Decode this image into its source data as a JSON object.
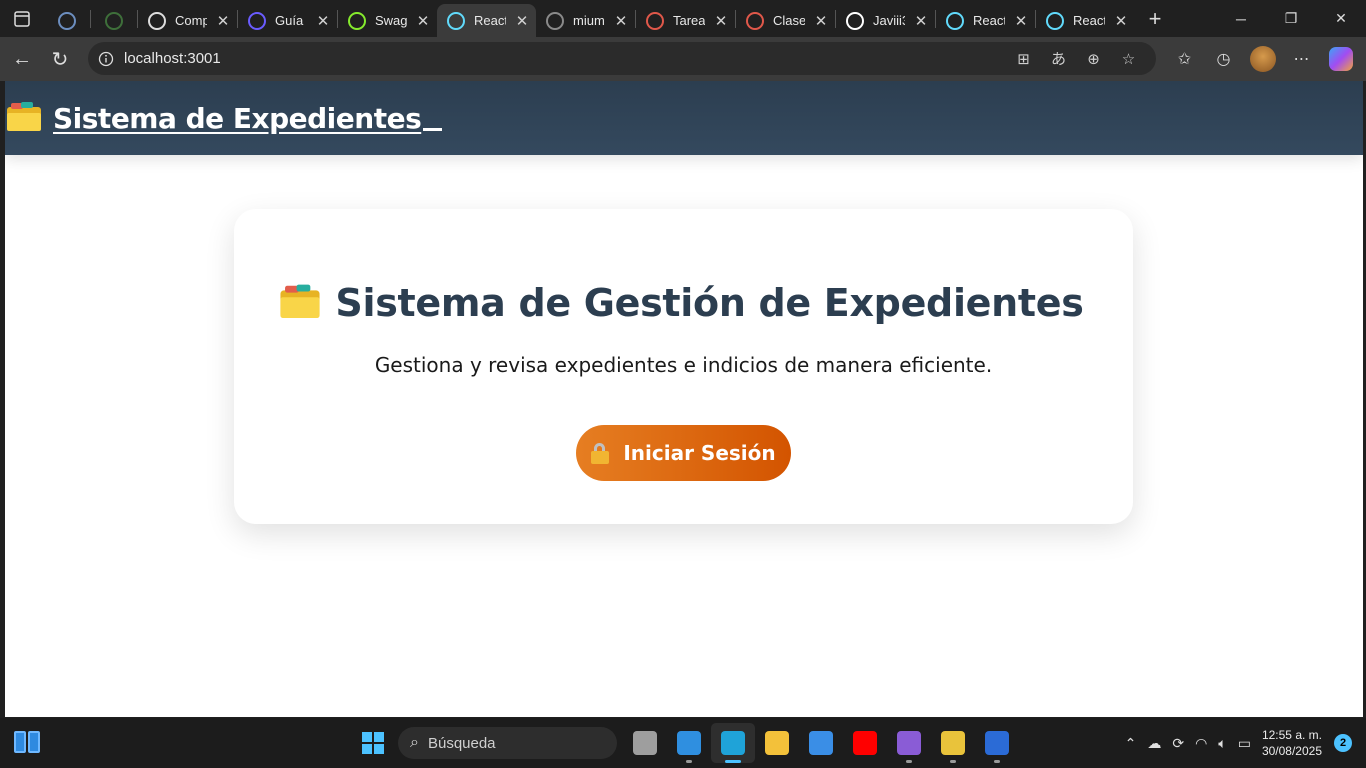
{
  "browser": {
    "tabs": [
      {
        "title": "",
        "icon": "app-icon",
        "color": "#6c8ebf"
      },
      {
        "title": "",
        "icon": "app-icon",
        "color": "#3e6f3a"
      },
      {
        "title": "Comp",
        "icon": "chatgpt-icon",
        "color": "#dddddd"
      },
      {
        "title": "Guía",
        "icon": "app-icon",
        "color": "#6a5cff"
      },
      {
        "title": "Swag",
        "icon": "swagger-icon",
        "color": "#85ea2d"
      },
      {
        "title": "React",
        "icon": "react-icon",
        "color": "#61dafb"
      },
      {
        "title": "mium",
        "icon": "app-icon",
        "color": "#8a8a8a"
      },
      {
        "title": "Tarea",
        "icon": "app-icon",
        "color": "#e0584a"
      },
      {
        "title": "Clase",
        "icon": "app-icon",
        "color": "#e0584a"
      },
      {
        "title": "Javiii3",
        "icon": "github-icon",
        "color": "#ffffff"
      },
      {
        "title": "React",
        "icon": "react-icon",
        "color": "#61dafb"
      },
      {
        "title": "React",
        "icon": "react-icon",
        "color": "#61dafb"
      }
    ],
    "active_tab_index": 5,
    "url": "localhost:3001"
  },
  "app": {
    "header_title": "Sistema de Expedientes",
    "card_title": "Sistema de Gestión de Expedientes",
    "card_subtitle": "Gestiona y revisa expedientes e indicios de manera eficiente.",
    "login_button": "Iniciar Sesión",
    "colors": {
      "header": "#2c3e50",
      "title": "#2c3e50",
      "button_start": "#e67e22",
      "button_end": "#d35400"
    }
  },
  "taskbar": {
    "search_placeholder": "Búsqueda",
    "apps": [
      {
        "name": "task-view-icon",
        "color": "#9e9e9e"
      },
      {
        "name": "vscode-icon",
        "color": "#2f8fe0"
      },
      {
        "name": "edge-icon",
        "color": "#1fa3d8"
      },
      {
        "name": "file-explorer-icon",
        "color": "#f3c13a"
      },
      {
        "name": "store-icon",
        "color": "#3a8ee6"
      },
      {
        "name": "youtube-icon",
        "color": "#ff0000"
      },
      {
        "name": "visual-studio-icon",
        "color": "#8a5cd6"
      },
      {
        "name": "paint-icon",
        "color": "#e9c33b"
      },
      {
        "name": "word-icon",
        "color": "#2b6bd6"
      }
    ],
    "active_app_index": 2,
    "time": "12:55 a. m.",
    "date": "30/08/2025",
    "notifications": "2"
  }
}
